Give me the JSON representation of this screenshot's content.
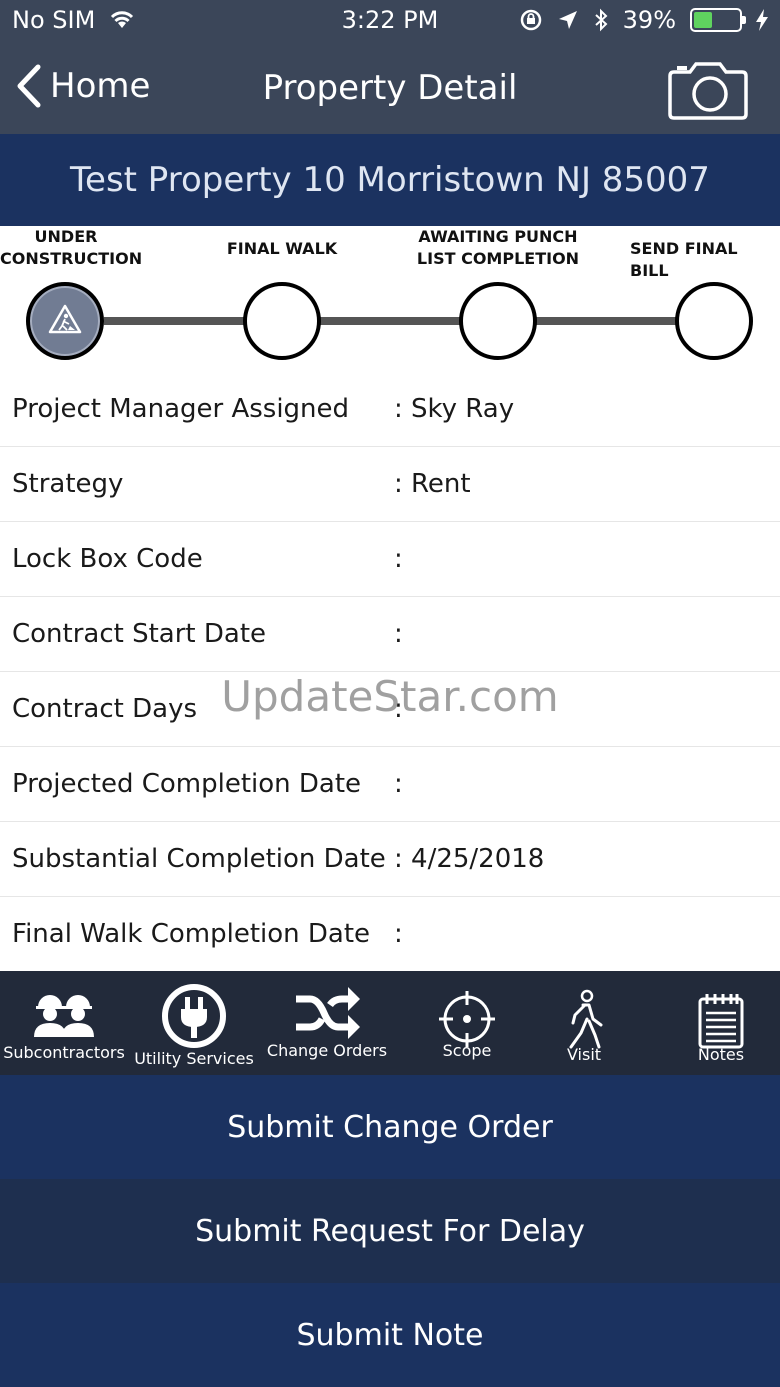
{
  "status": {
    "carrier": "No SIM",
    "time": "3:22 PM",
    "battery": "39%"
  },
  "nav": {
    "back_label": "Home",
    "title": "Property Detail"
  },
  "property": {
    "title": "Test Property 10 Morristown NJ 85007"
  },
  "steps": [
    {
      "line1": "UNDER",
      "line2": "CONSTRUCTION"
    },
    {
      "line1": "FINAL WALK",
      "line2": ""
    },
    {
      "line1": "AWAITING PUNCH",
      "line2": "LIST COMPLETION"
    },
    {
      "line1": "SEND FINAL BILL",
      "line2": ""
    }
  ],
  "details": [
    {
      "label": "Project Manager Assigned",
      "value": ": Sky Ray"
    },
    {
      "label": "Strategy",
      "value": ": Rent"
    },
    {
      "label": "Lock Box Code",
      "value": ":"
    },
    {
      "label": "Contract Start Date",
      "value": ":"
    },
    {
      "label": "Contract Days",
      "value": ":"
    },
    {
      "label": "Projected Completion Date",
      "value": ":"
    },
    {
      "label": "Substantial Completion Date",
      "value": ": 4/25/2018"
    },
    {
      "label": "Final Walk Completion Date",
      "value": ":"
    }
  ],
  "watermark": "UpdateStar.com",
  "tabs": [
    {
      "label": "Subcontractors",
      "icon": "workers-icon"
    },
    {
      "label": "Utility Services",
      "icon": "plug-icon"
    },
    {
      "label": "Change Orders",
      "icon": "shuffle-icon"
    },
    {
      "label": "Scope",
      "icon": "crosshair-icon"
    },
    {
      "label": "Visit",
      "icon": "walking-person-icon"
    },
    {
      "label": "Notes",
      "icon": "notepad-icon"
    }
  ],
  "actions": {
    "change_order": "Submit Change Order",
    "request_delay": "Submit Request For Delay",
    "note": "Submit Note"
  }
}
